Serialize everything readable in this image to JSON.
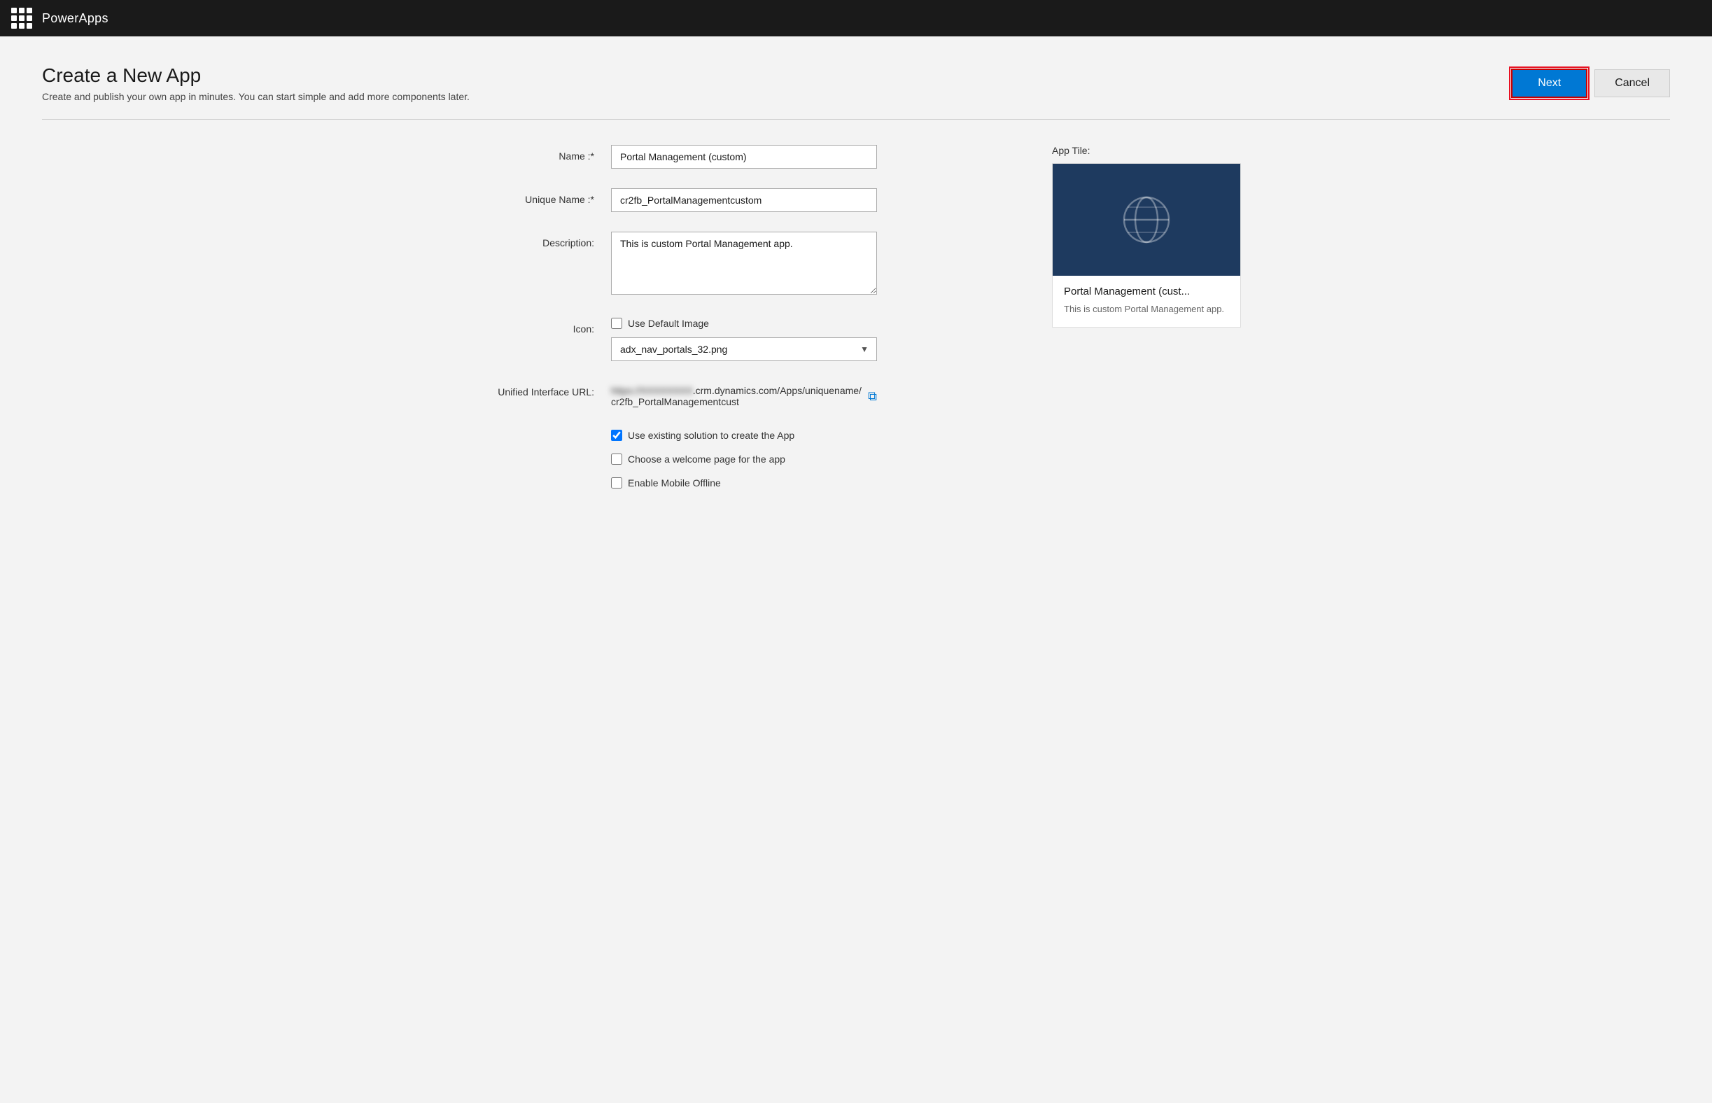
{
  "topbar": {
    "title": "PowerApps",
    "waffle_label": "App launcher"
  },
  "header": {
    "title": "Create a New App",
    "subtitle": "Create and publish your own app in minutes. You can start simple and add more components later.",
    "next_button": "Next",
    "cancel_button": "Cancel"
  },
  "form": {
    "name_label": "Name :*",
    "name_value": "Portal Management (custom)",
    "unique_name_label": "Unique Name :*",
    "unique_name_value": "cr2fb_PortalManagementcustom",
    "description_label": "Description:",
    "description_value": "This is custom Portal Management app.",
    "icon_label": "Icon:",
    "use_default_image_label": "Use Default Image",
    "use_default_image_checked": false,
    "icon_dropdown_value": "adx_nav_portals_32.png",
    "icon_dropdown_options": [
      "adx_nav_portals_32.png"
    ],
    "url_label": "Unified Interface URL:",
    "url_blurred": "https://",
    "url_domain_blurred": "XXXXXXXX",
    "url_suffix": ".crm.dynamics.com/Apps/uniquename/cr2fb_PortalManagementcust",
    "url_full": "https://[redacted].crm.dynamics.com/Apps/uniquename/cr2fb_PortalManagementcust",
    "copy_icon": "⧉",
    "checkbox1_label": "Use existing solution to create the App",
    "checkbox1_checked": true,
    "checkbox2_label": "Choose a welcome page for the app",
    "checkbox2_checked": false,
    "checkbox3_label": "Enable Mobile Offline",
    "checkbox3_checked": false
  },
  "app_tile": {
    "label": "App Tile:",
    "name": "Portal Management (cust...",
    "description": "This is custom Portal Management app."
  }
}
